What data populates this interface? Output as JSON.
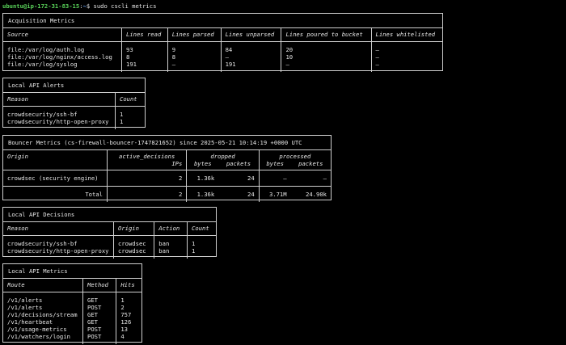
{
  "prompt": {
    "user_host": "ubuntu@ip-172-31-83-15",
    "sep": ":",
    "path": "~",
    "dollar": "$",
    "command": " sudo cscli metrics"
  },
  "acquisition": {
    "title": "Acquisition Metrics",
    "headers": [
      "Source",
      "Lines read",
      "Lines parsed",
      "Lines unparsed",
      "Lines poured to bucket",
      "Lines whitelisted"
    ],
    "rows": [
      [
        "file:/var/log/auth.log",
        "93",
        "9",
        "84",
        "20",
        "–"
      ],
      [
        "file:/var/log/nginx/access.log",
        "8",
        "8",
        "–",
        "10",
        "–"
      ],
      [
        "file:/var/log/syslog",
        "191",
        "–",
        "191",
        "–",
        "–"
      ]
    ]
  },
  "alerts": {
    "title": "Local API Alerts",
    "headers": [
      "Reason",
      "Count"
    ],
    "rows": [
      [
        "crowdsecurity/ssh-bf",
        "1"
      ],
      [
        "crowdsecurity/http-open-proxy",
        "1"
      ]
    ]
  },
  "bouncer": {
    "title": "Bouncer Metrics (cs-firewall-bouncer-1747821652) since 2025-05-21 10:14:19 +0000 UTC",
    "h_origin": "Origin",
    "h_active": "active_decisions",
    "h_ips": "IPs",
    "h_dropped": "dropped",
    "h_processed": "processed",
    "h_bytes": "bytes",
    "h_packets": "packets",
    "rows": [
      [
        "crowdsec (security engine)",
        "2",
        "1.36k",
        "24",
        "–",
        "–"
      ]
    ],
    "total": [
      "Total",
      "2",
      "1.36k",
      "24",
      "3.71M",
      "24.90k"
    ]
  },
  "decisions": {
    "title": "Local API Decisions",
    "headers": [
      "Reason",
      "Origin",
      "Action",
      "Count"
    ],
    "rows": [
      [
        "crowdsecurity/ssh-bf",
        "crowdsec",
        "ban",
        "1"
      ],
      [
        "crowdsecurity/http-open-proxy",
        "crowdsec",
        "ban",
        "1"
      ]
    ]
  },
  "api_metrics": {
    "title": "Local API Metrics",
    "headers": [
      "Route",
      "Method",
      "Hits"
    ],
    "rows": [
      [
        "/v1/alerts",
        "GET",
        "1"
      ],
      [
        "/v1/alerts",
        "POST",
        "2"
      ],
      [
        "/v1/decisions/stream",
        "GET",
        "757"
      ],
      [
        "/v1/heartbeat",
        "GET",
        "126"
      ],
      [
        "/v1/usage-metrics",
        "POST",
        "13"
      ],
      [
        "/v1/watchers/login",
        "POST",
        "4"
      ]
    ]
  }
}
